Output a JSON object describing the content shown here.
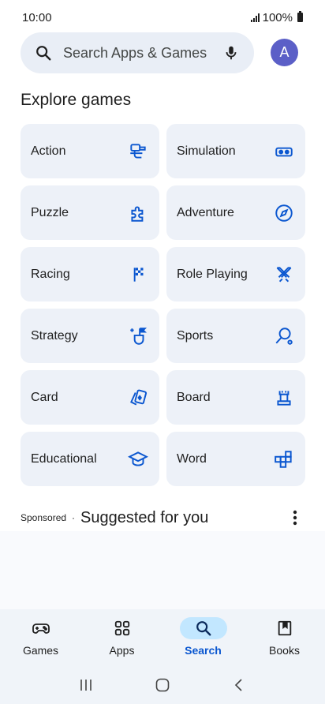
{
  "status": {
    "time": "10:00",
    "battery": "100%"
  },
  "search": {
    "placeholder": "Search Apps & Games"
  },
  "avatar": {
    "initial": "A",
    "color": "#5b5fc7"
  },
  "explore": {
    "title": "Explore games",
    "tiles": [
      {
        "label": "Action",
        "icon": "action-icon"
      },
      {
        "label": "Simulation",
        "icon": "vr-headset-icon"
      },
      {
        "label": "Puzzle",
        "icon": "puzzle-piece-icon"
      },
      {
        "label": "Adventure",
        "icon": "compass-icon"
      },
      {
        "label": "Racing",
        "icon": "checkered-flag-icon"
      },
      {
        "label": "Role Playing",
        "icon": "crossed-swords-icon"
      },
      {
        "label": "Strategy",
        "icon": "strategy-icon"
      },
      {
        "label": "Sports",
        "icon": "racket-icon"
      },
      {
        "label": "Card",
        "icon": "cards-icon"
      },
      {
        "label": "Board",
        "icon": "chess-rook-icon"
      },
      {
        "label": "Educational",
        "icon": "graduation-cap-icon"
      },
      {
        "label": "Word",
        "icon": "word-blocks-icon"
      }
    ]
  },
  "suggested": {
    "sponsored": "Sponsored",
    "separator": "·",
    "title": "Suggested for you"
  },
  "bottom_nav": [
    {
      "label": "Games",
      "icon": "gamepad-icon",
      "active": false
    },
    {
      "label": "Apps",
      "icon": "apps-grid-icon",
      "active": false
    },
    {
      "label": "Search",
      "icon": "search-icon",
      "active": true
    },
    {
      "label": "Books",
      "icon": "book-icon",
      "active": false
    }
  ],
  "colors": {
    "accent": "#0b57d0",
    "tile_bg": "#edf1f8",
    "search_bg": "#e9eef6",
    "icon": "#0b57d0"
  }
}
